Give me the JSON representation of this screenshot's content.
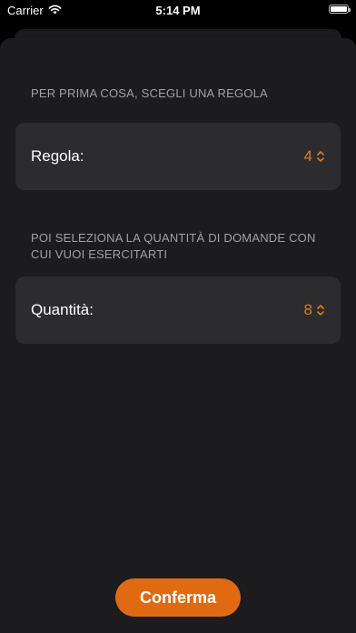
{
  "status_bar": {
    "carrier": "Carrier",
    "time": "5:14 PM"
  },
  "sections": [
    {
      "header": "PER PRIMA COSA, SCEGLI UNA REGOLA",
      "picker_label": "Regola:",
      "picker_value": "4"
    },
    {
      "header": "POI SELEZIONA LA QUANTITÀ DI DOMANDE CON CUI VUOI ESERCITARTI",
      "picker_label": "Quantità:",
      "picker_value": "8"
    }
  ],
  "confirm_label": "Conferma",
  "colors": {
    "accent": "#e06a12",
    "picker_value": "#e07a1b",
    "background": "#000000",
    "sheet": "#1c1c1e",
    "row": "#2c2c2e",
    "header_text": "#a0a0a5"
  },
  "icons": {
    "wifi": "wifi-icon",
    "battery": "battery-icon",
    "picker": "chevron-up-down-icon"
  }
}
